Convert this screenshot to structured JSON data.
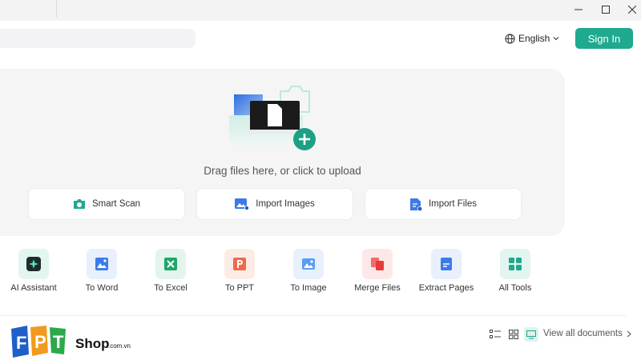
{
  "header": {
    "language_label": "English",
    "signin_label": "Sign In"
  },
  "upload": {
    "drop_text": "Drag files here, or click to upload",
    "actions": [
      {
        "label": "Smart Scan",
        "icon": "camera-icon"
      },
      {
        "label": "Import Images",
        "icon": "image-import-icon"
      },
      {
        "label": "Import Files",
        "icon": "file-import-icon"
      }
    ]
  },
  "tools": [
    {
      "label": "AI Assistant",
      "icon": "ai-sparkle-icon"
    },
    {
      "label": "To Word",
      "icon": "word-icon"
    },
    {
      "label": "To Excel",
      "icon": "excel-icon"
    },
    {
      "label": "To PPT",
      "icon": "ppt-icon"
    },
    {
      "label": "To Image",
      "icon": "image-icon"
    },
    {
      "label": "Merge Files",
      "icon": "merge-icon"
    },
    {
      "label": "Extract Pages",
      "icon": "extract-icon"
    },
    {
      "label": "All Tools",
      "icon": "grid-apps-icon"
    }
  ],
  "footer": {
    "view_all_label": "View all documents",
    "logo_text": "FPT Shop.com.vn"
  },
  "colors": {
    "accent": "#1fa98f",
    "word": "#3b7be8",
    "excel": "#20a56a",
    "ppt": "#ec6a4c",
    "merge": "#e63b3b"
  }
}
